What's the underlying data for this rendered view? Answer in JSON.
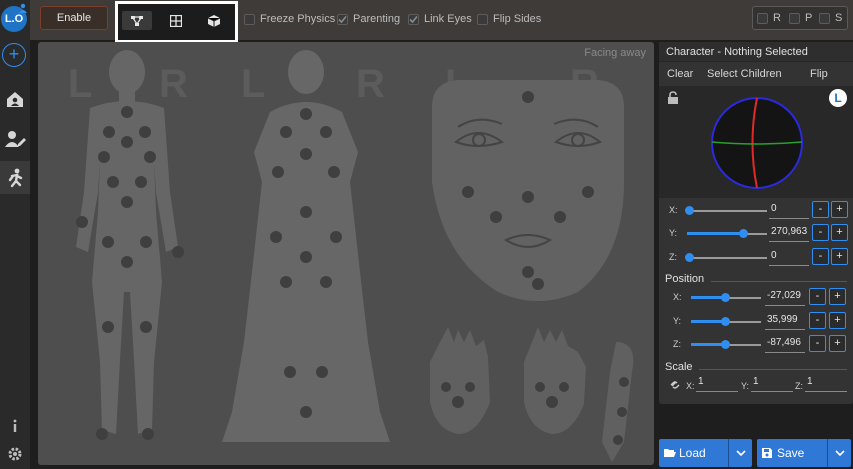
{
  "sidebar": {
    "avatar_initials": "L.O",
    "add_label": "+",
    "icons": [
      "home-icon",
      "user-edit-icon",
      "running-figure-icon",
      "info-icon",
      "settings-gear-icon"
    ]
  },
  "toolbar": {
    "enable_label": "Enable",
    "modes": [
      "skeleton-mode-icon",
      "grid-mode-icon",
      "cube-mode-icon"
    ],
    "options": [
      {
        "label": "Freeze Physics",
        "checked": false
      },
      {
        "label": "Parenting",
        "checked": true
      },
      {
        "label": "Link Eyes",
        "checked": true
      },
      {
        "label": "Flip Sides",
        "checked": false
      }
    ],
    "mirror_flags": [
      {
        "label": "R",
        "checked": false
      },
      {
        "label": "P",
        "checked": false
      },
      {
        "label": "S",
        "checked": false
      }
    ]
  },
  "viewport": {
    "facing_label": "Facing away",
    "side_letters": [
      "L",
      "R",
      "L",
      "R",
      "L",
      "R"
    ]
  },
  "panel": {
    "title": "Character - Nothing Selected",
    "menu": [
      "Clear",
      "Select Children",
      "Flip"
    ],
    "side_badge": "L",
    "rotation": [
      {
        "axis": "X:",
        "value": "0",
        "level": 0.0
      },
      {
        "axis": "Y:",
        "value": "270,963",
        "level": 0.75
      },
      {
        "axis": "Z:",
        "value": "0",
        "level": 0.0
      }
    ],
    "position_title": "Position",
    "position": [
      {
        "axis": "X:",
        "value": "-27,029",
        "level": 0.5
      },
      {
        "axis": "Y:",
        "value": "35,999",
        "level": 0.5
      },
      {
        "axis": "Z:",
        "value": "-87,496",
        "level": 0.5
      }
    ],
    "scale_title": "Scale",
    "scale": [
      {
        "axis": "X:",
        "value": "1"
      },
      {
        "axis": "Y:",
        "value": "1"
      },
      {
        "axis": "Z:",
        "value": "1"
      }
    ],
    "minus": "-",
    "plus": "+"
  },
  "footer": {
    "load_label": "Load",
    "save_label": "Save"
  },
  "colors": {
    "accent": "#2f8ef0",
    "button_blue": "#2f78d6",
    "highlight_box": "#ffffff"
  }
}
